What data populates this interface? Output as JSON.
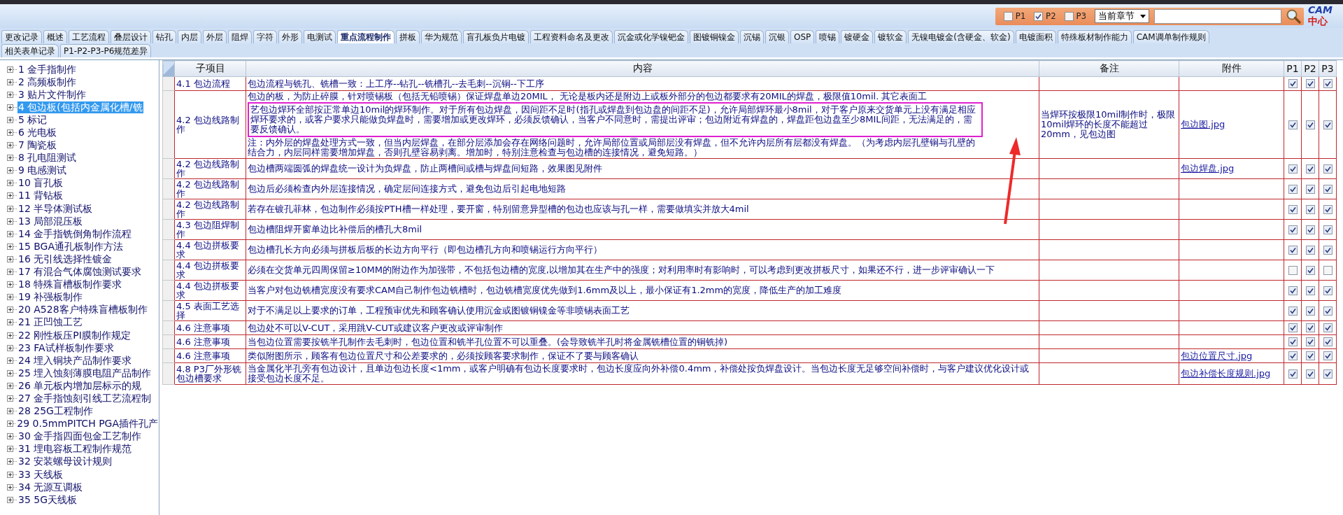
{
  "toolbar": {
    "filters": [
      {
        "label": "P1",
        "checked": false
      },
      {
        "label": "P2",
        "checked": true
      },
      {
        "label": "P3",
        "checked": false
      }
    ],
    "scope": "当前章节",
    "logo": {
      "latin": "CAM",
      "cjk": "中心"
    }
  },
  "tab_rows": [
    {
      "tabs": [
        {
          "label": "更改记录",
          "selected": false
        },
        {
          "label": "概述",
          "selected": false
        },
        {
          "label": "工艺流程",
          "selected": false
        },
        {
          "label": "叠层设计",
          "selected": false
        },
        {
          "label": "钻孔",
          "selected": false
        },
        {
          "label": "内层",
          "selected": false
        },
        {
          "label": "外层",
          "selected": false
        },
        {
          "label": "阻焊",
          "selected": false
        },
        {
          "label": "字符",
          "selected": false
        },
        {
          "label": "外形",
          "selected": false
        },
        {
          "label": "电测试",
          "selected": false
        },
        {
          "label": "重点流程制作",
          "selected": true
        },
        {
          "label": "拼板",
          "selected": false
        },
        {
          "label": "华为规范",
          "selected": false
        },
        {
          "label": "盲孔板负片电镀",
          "selected": false
        },
        {
          "label": "工程资料命名及更改",
          "selected": false
        },
        {
          "label": "沉金或化学镍钯金",
          "selected": false
        },
        {
          "label": "图镀铜镍金",
          "selected": false
        },
        {
          "label": "沉锡",
          "selected": false
        },
        {
          "label": "沉银",
          "selected": false
        },
        {
          "label": "OSP",
          "selected": false
        },
        {
          "label": "喷锡",
          "selected": false
        },
        {
          "label": "镀硬金",
          "selected": false
        },
        {
          "label": "镀软金",
          "selected": false
        },
        {
          "label": "无镍电镀金(含硬金、软金)",
          "selected": false
        },
        {
          "label": "电镀面积",
          "selected": false
        },
        {
          "label": "特殊板材制作能力",
          "selected": false
        },
        {
          "label": "CAM调单制作规则",
          "selected": false
        }
      ]
    },
    {
      "tabs": [
        {
          "label": "相关表单记录",
          "selected": false
        },
        {
          "label": "P1-P2-P3-P6规范差异",
          "selected": false
        }
      ]
    }
  ],
  "tree": {
    "items": [
      {
        "label": "1 金手指制作",
        "expanded": false,
        "selected": false
      },
      {
        "label": "2 高频板制作",
        "expanded": false,
        "selected": false
      },
      {
        "label": "3 贴片文件制作",
        "expanded": false,
        "selected": false
      },
      {
        "label": "4 包边板(包括内金属化槽/铣",
        "expanded": false,
        "selected": true
      },
      {
        "label": "5 标记",
        "expanded": false,
        "selected": false
      },
      {
        "label": "6 光电板",
        "expanded": false,
        "selected": false
      },
      {
        "label": "7 陶瓷板",
        "expanded": false,
        "selected": false
      },
      {
        "label": "8 孔电阻测试",
        "expanded": false,
        "selected": false
      },
      {
        "label": "9 电感测试",
        "expanded": false,
        "selected": false
      },
      {
        "label": "10 盲孔板",
        "expanded": false,
        "selected": false
      },
      {
        "label": "11 背钻板",
        "expanded": false,
        "selected": false
      },
      {
        "label": "12 半导体测试板",
        "expanded": false,
        "selected": false
      },
      {
        "label": "13 局部混压板",
        "expanded": false,
        "selected": false
      },
      {
        "label": "14 金手指铣倒角制作流程",
        "expanded": false,
        "selected": false
      },
      {
        "label": "15 BGA通孔板制作方法",
        "expanded": false,
        "selected": false
      },
      {
        "label": "16 无引线选择性镀金",
        "expanded": false,
        "selected": false
      },
      {
        "label": "17 有混合气体腐蚀测试要求",
        "expanded": false,
        "selected": false
      },
      {
        "label": "18 特殊盲槽板制作要求",
        "expanded": false,
        "selected": false
      },
      {
        "label": "19 补强板制作",
        "expanded": false,
        "selected": false
      },
      {
        "label": "20 A528客户特殊盲槽板制作",
        "expanded": false,
        "selected": false
      },
      {
        "label": "21 正凹蚀工艺",
        "expanded": false,
        "selected": false
      },
      {
        "label": "22 刚性板压PI膜制作规定",
        "expanded": false,
        "selected": false
      },
      {
        "label": "23 FA试样板制作要求",
        "expanded": false,
        "selected": false
      },
      {
        "label": "24 埋入铜块产品制作要求",
        "expanded": false,
        "selected": false
      },
      {
        "label": "25 埋入蚀刻薄膜电阻产品制作",
        "expanded": false,
        "selected": false
      },
      {
        "label": "26 单元板内增加层标示的规",
        "expanded": false,
        "selected": false
      },
      {
        "label": "27 金手指蚀刻引线工艺流程制",
        "expanded": false,
        "selected": false
      },
      {
        "label": "28 25G工程制作",
        "expanded": false,
        "selected": false
      },
      {
        "label": "29 0.5mmPITCH PGA插件孔产",
        "expanded": false,
        "selected": false
      },
      {
        "label": "30 金手指四面包金工艺制作",
        "expanded": false,
        "selected": false
      },
      {
        "label": "31 埋电容板工程制作规范",
        "expanded": false,
        "selected": false
      },
      {
        "label": "32 安装螺母设计规则",
        "expanded": false,
        "selected": false
      },
      {
        "label": "33 天线板",
        "expanded": false,
        "selected": false
      },
      {
        "label": "34 无源互调板",
        "expanded": false,
        "selected": false
      },
      {
        "label": "35 5G天线板",
        "expanded": false,
        "selected": false
      }
    ]
  },
  "table": {
    "columns": [
      "子项目",
      "内容",
      "备注",
      "附件",
      "P1",
      "P2",
      "P3"
    ],
    "rows": [
      {
        "item": "4.1 包边流程",
        "content": "包边流程与铣孔、铣槽一致：上工序--钻孔--铣槽孔--去毛刺--沉铜--下工序",
        "p1": true,
        "p2": true,
        "p3": true
      },
      {
        "item": "4.2 包边线路制作",
        "content": "包边的板，为防止碎膜，针对喷锡板（包括无铅喷锡）保证焊盘单边20MIL， 无论是板内还是附边上或板外部分的包边都要求有20MIL的焊盘，极限值10mil. 其它表面工",
        "content_2": "艺包边焊环全部按正常单边10mil的焊环制作。对于所有包边焊盘，因间距不足时(指孔或焊盘到包边盘的间距不足)，允许局部焊环最小8mil，对于客户原来交货单元上没有满足相应焊环要求的，或客户要求只能做负焊盘时，需要增加或更改焊环，必须反馈确认，当客户不同意时，需提出评审；包边附近有焊盘的，焊盘距包边盘至少8MIL间距，无法满足的，需要反馈确认。",
        "content_3": "注：内外层的焊盘处理方式一致，但当内层焊盘，在部分层添加会存在网络问题时，允许局部位置或局部层没有焊盘，但不允许内层所有层都没有焊盘。（为考虑内层孔壁铜与孔壁的结合力，内层同样需要增加焊盘，否则孔壁容易剥离。增加时，特别注意检查与包边槽的连接情况，避免短路。）",
        "note": "当焊环按极限10mil制作时，极限10mil焊环的长度不能超过20mm，见包边图",
        "attachment": "包边图.jpg",
        "p1": true,
        "p2": true,
        "p3": true
      },
      {
        "item": "4.2 包边线路制作",
        "content": "包边槽两端圆弧的焊盘统一设计为负焊盘，防止两槽间或槽与焊盘间短路，效果图见附件",
        "attachment": "包边焊盘.jpg",
        "p1": true,
        "p2": true,
        "p3": true
      },
      {
        "item": "4.2 包边线路制作",
        "content": "包边后必须检查内外层连接情况，确定层间连接方式，避免包边后引起电地短路",
        "p1": true,
        "p2": true,
        "p3": true
      },
      {
        "item": "4.2 包边线路制作",
        "content": "若存在镀孔菲林，包边制作必须按PTH槽一样处理，要开窗，特别留意异型槽的包边也应该与孔一样，需要做填实并放大4mil",
        "p1": true,
        "p2": true,
        "p3": true
      },
      {
        "item": "4.3 包边阻焊制作",
        "content": "包边槽阻焊开窗单边比补偿后的槽孔大8mil",
        "p1": true,
        "p2": true,
        "p3": true
      },
      {
        "item": "4.4 包边拼板要求",
        "content": "包边槽孔长方向必须与拼板后板的长边方向平行（即包边槽孔方向和喷锡运行方向平行）",
        "p1": true,
        "p2": true,
        "p3": true
      },
      {
        "item": "4.4 包边拼板要求",
        "content": "必须在交货单元四周保留≥10MM的附边作为加强带，不包括包边槽的宽度,以增加其在生产中的强度；对利用率时有影响时，可以考虑到更改拼板尺寸，如果还不行，进一步评审确认一下",
        "p1": false,
        "p2": true,
        "p3": false
      },
      {
        "item": "4.4 包边拼板要求",
        "content": "当客户对包边铣槽宽度没有要求CAM自己制作包边铣槽时，包边铣槽宽度优先做到1.6mm及以上，最小保证有1.2mm的宽度，降低生产的加工难度",
        "p1": true,
        "p2": true,
        "p3": true
      },
      {
        "item": "4.5 表面工艺选择",
        "content": "对于不满足以上要求的订单，工程预审优先和顾客确认使用沉金或图镀铜镍金等非喷锡表面工艺",
        "p1": true,
        "p2": true,
        "p3": true
      },
      {
        "item": "4.6 注意事项",
        "content": "包边处不可以V-CUT，采用跳V-CUT或建议客户更改或评审制作",
        "p1": true,
        "p2": true,
        "p3": true
      },
      {
        "item": "4.6 注意事项",
        "content": "当包边位置需要按铣半孔制作去毛刺时，包边位置和铣半孔位置不可以重叠。(会导致铣半孔时将金属铣槽位置的铜铣掉)",
        "p1": true,
        "p2": true,
        "p3": true
      },
      {
        "item": "4.6 注意事项",
        "content": "类似附图所示，顾客有包边位置尺寸和公差要求的，必须按顾客要求制作，保证不了要与顾客确认",
        "attachment": "包边位置尺寸.jpg",
        "p1": true,
        "p2": true,
        "p3": true
      },
      {
        "item": "4.8 P3厂外形铣包边槽要求",
        "content": "当金属化半孔旁有包边设计，且单边包边长度<1mm，或客户明确有包边长度要求时，包边长度应向外补偿0.4mm，补偿处按负焊盘设计。当包边长度无足够空间补偿时，与客户建议优化设计或接受包边长度不足。",
        "attachment": "包边补偿长度规则.jpg",
        "p1": true,
        "p2": true,
        "p3": true
      }
    ]
  }
}
